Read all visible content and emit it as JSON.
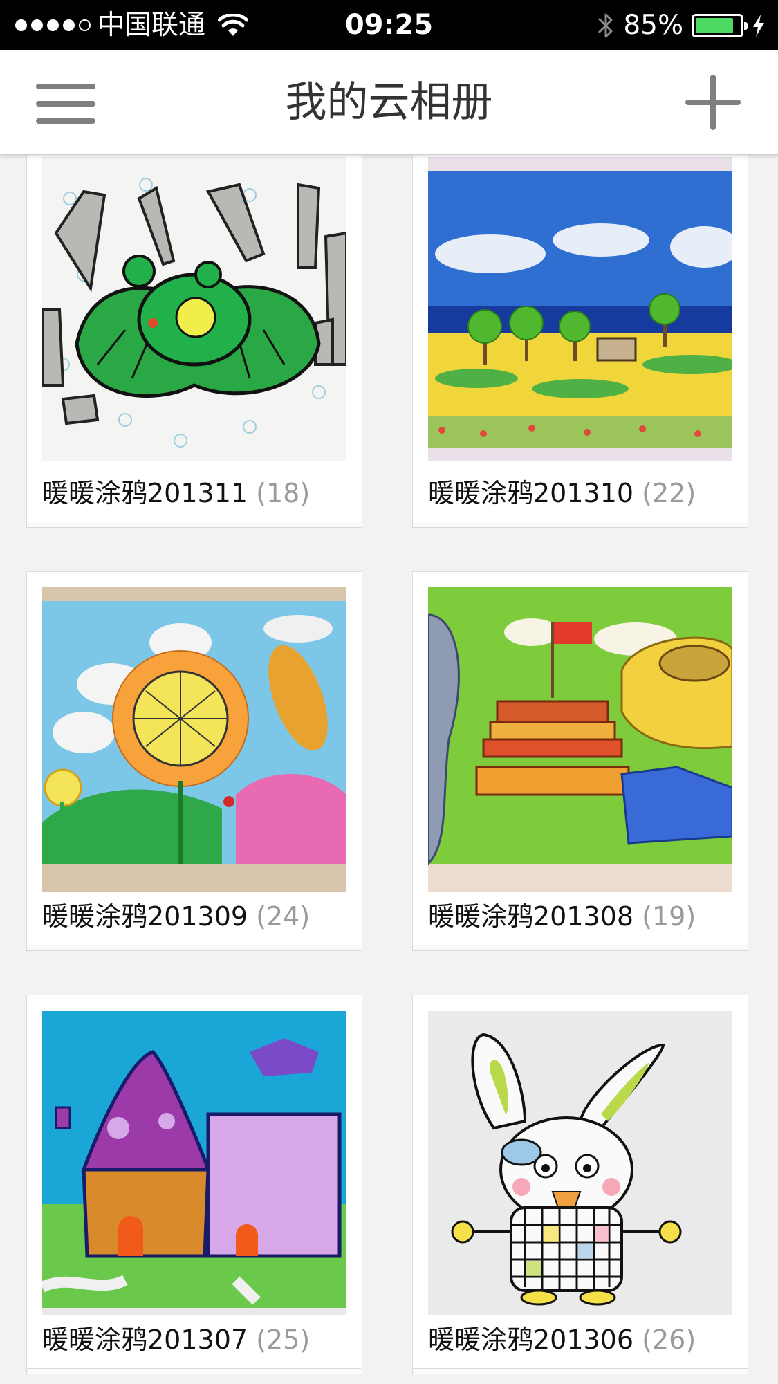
{
  "status_bar": {
    "carrier": "中国联通",
    "time": "09:25",
    "battery_percent": "85%",
    "battery_level": 0.85,
    "signal_bars": 4
  },
  "nav": {
    "title": "我的云相册",
    "menu_icon": "hamburger-menu-icon",
    "add_icon": "plus-icon"
  },
  "albums": [
    {
      "name": "暖暖涂鸦201311",
      "count": "(18)"
    },
    {
      "name": "暖暖涂鸦201310",
      "count": "(22)"
    },
    {
      "name": "暖暖涂鸦201309",
      "count": "(24)"
    },
    {
      "name": "暖暖涂鸦201308",
      "count": "(19)"
    },
    {
      "name": "暖暖涂鸦201307",
      "count": "(25)"
    },
    {
      "name": "暖暖涂鸦201306",
      "count": "(26)"
    }
  ],
  "colors": {
    "status_bar_bg": "#000000",
    "battery_fill": "#4cd964",
    "nav_bg": "#ffffff",
    "icon_gray": "#7f7f7f",
    "count_gray": "#9a9a9a",
    "page_bg": "#f2f2f2"
  }
}
